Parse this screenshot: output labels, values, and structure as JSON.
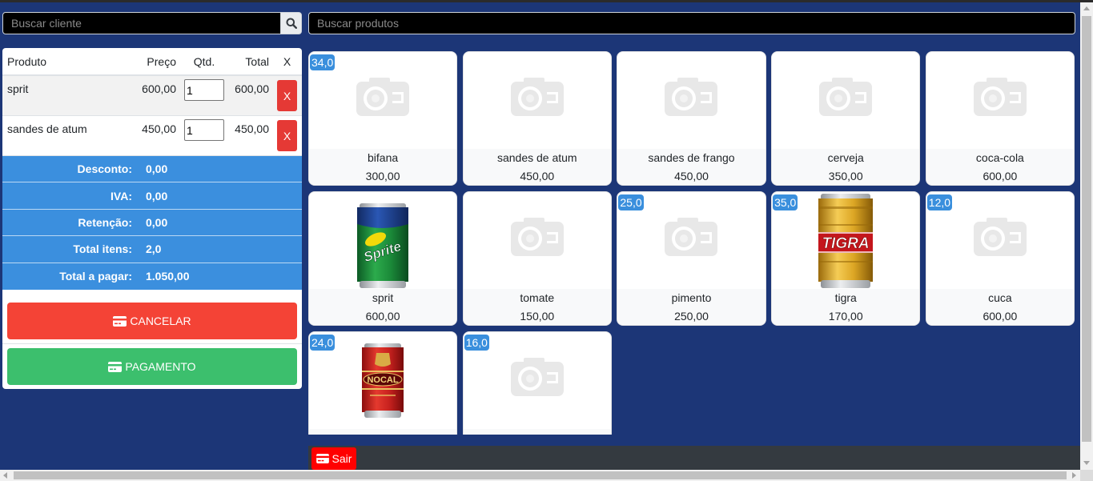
{
  "client_search": {
    "placeholder": "Buscar cliente",
    "button_icon": "search-icon"
  },
  "product_search": {
    "placeholder": "Buscar produtos"
  },
  "cart": {
    "headers": {
      "product": "Produto",
      "price": "Preço",
      "qty": "Qtd.",
      "total": "Total",
      "remove": "X"
    },
    "items": [
      {
        "name": "sprit",
        "price": "600,00",
        "qty": "1",
        "total": "600,00",
        "remove_label": "X"
      },
      {
        "name": "sandes de atum",
        "price": "450,00",
        "qty": "1",
        "total": "450,00",
        "remove_label": "X"
      }
    ],
    "summary": [
      {
        "label": "Desconto:",
        "value": "0,00"
      },
      {
        "label": "IVA:",
        "value": "0,00"
      },
      {
        "label": "Retenção:",
        "value": "0,00"
      },
      {
        "label": "Total itens:",
        "value": "2,0"
      },
      {
        "label": "Total a pagar:",
        "value": "1.050,00"
      }
    ],
    "cancel_button": {
      "label": "CANCELAR",
      "icon": "credit-card-icon"
    },
    "pay_button": {
      "label": "PAGAMENTO",
      "icon": "credit-card-icon"
    }
  },
  "products": [
    {
      "name": "bifana",
      "price": "300,00",
      "stock": "34,0",
      "image": "camera-placeholder-icon"
    },
    {
      "name": "sandes de atum",
      "price": "450,00",
      "image": "camera-placeholder-icon"
    },
    {
      "name": "sandes de frango",
      "price": "450,00",
      "image": "camera-placeholder-icon"
    },
    {
      "name": "cerveja",
      "price": "350,00",
      "image": "camera-placeholder-icon"
    },
    {
      "name": "coca-cola",
      "price": "600,00",
      "image": "camera-placeholder-icon"
    },
    {
      "name": "sprit",
      "price": "600,00",
      "image": "sprite-can",
      "logo": "Sprite"
    },
    {
      "name": "tomate",
      "price": "150,00",
      "image": "camera-placeholder-icon"
    },
    {
      "name": "pimento",
      "price": "250,00",
      "stock": "25,0",
      "image": "camera-placeholder-icon"
    },
    {
      "name": "tigra",
      "price": "170,00",
      "stock": "35,0",
      "image": "tigra-can",
      "logo": "TIGRA"
    },
    {
      "name": "cuca",
      "price": "600,00",
      "stock": "12,0",
      "image": "camera-placeholder-icon"
    },
    {
      "stock": "24,0",
      "image": "nocal-can",
      "logo": "NOCAL"
    },
    {
      "stock": "16,0",
      "image": "camera-placeholder-icon"
    }
  ],
  "footer": {
    "exit_button": {
      "label": "Sair",
      "icon": "credit-card-icon"
    }
  },
  "colors": {
    "page_background": "#1c3677",
    "summary_background": "#3b8fde",
    "cancel_button": "#f44336",
    "pay_button": "#3cbf6d",
    "remove_button": "#e53935",
    "stock_badge": "#3a8fdd",
    "footer_bar": "#343a40",
    "exit_button": "#ff0000"
  }
}
